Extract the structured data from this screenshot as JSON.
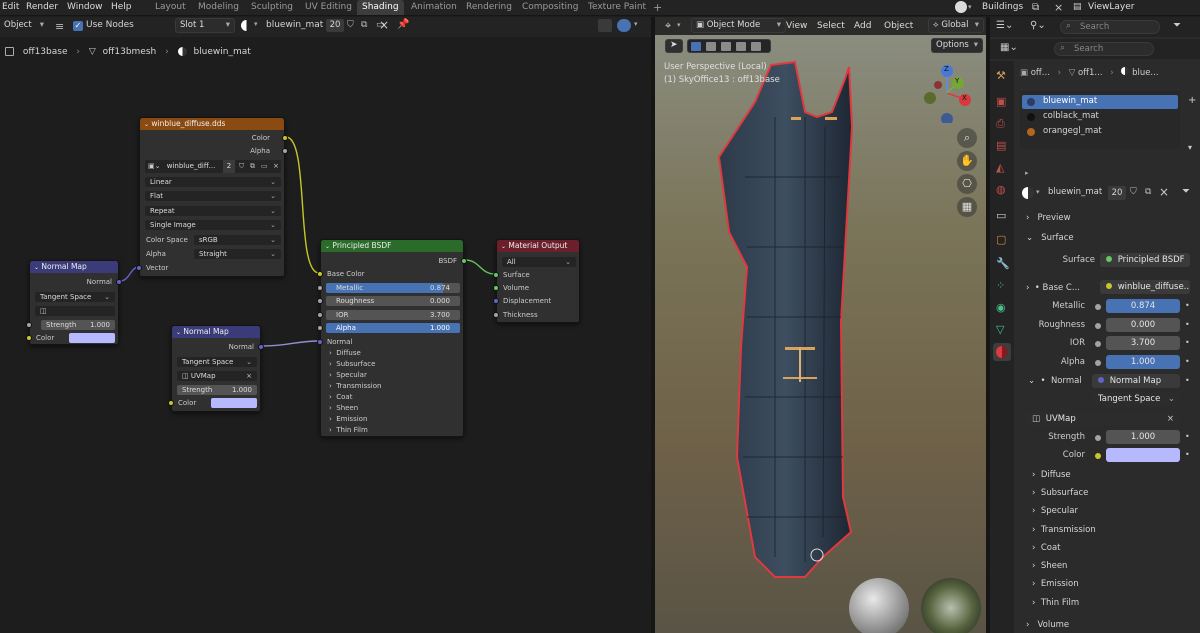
{
  "topbar": {
    "menus": [
      "Edit",
      "Render",
      "Window",
      "Help"
    ],
    "workspaces": [
      "Layout",
      "Modeling",
      "Sculpting",
      "UV Editing",
      "Shading",
      "Animation",
      "Rendering",
      "Compositing",
      "Texture Paint"
    ],
    "active_workspace": "Shading",
    "plus": "+",
    "scene": "Buildings",
    "viewlayer": "ViewLayer"
  },
  "node_editor": {
    "mode": "Object",
    "use_nodes": "Use Nodes",
    "slot": "Slot 1",
    "material": "bluewin_mat",
    "users": "20",
    "breadcrumb": [
      "off13base",
      "off13bmesh",
      "bluewin_mat"
    ],
    "image_node": {
      "title": "winblue_diffuse.dds",
      "out_color": "Color",
      "out_alpha": "Alpha",
      "image_name": "winblue_diff...",
      "image_users": "2",
      "interpolation": "Linear",
      "projection": "Flat",
      "extension": "Repeat",
      "source": "Single Image",
      "color_space_label": "Color Space",
      "color_space": "sRGB",
      "alpha_label": "Alpha",
      "alpha_mode": "Straight",
      "in_vector": "Vector"
    },
    "normal_map_1": {
      "title": "Normal Map",
      "out": "Normal",
      "space": "Tangent Space",
      "strength_label": "Strength",
      "strength": "1.000",
      "color_label": "Color"
    },
    "normal_map_2": {
      "title": "Normal Map",
      "out": "Normal",
      "space": "Tangent Space",
      "uv": "UVMap",
      "strength_label": "Strength",
      "strength": "1.000",
      "color_label": "Color"
    },
    "bsdf": {
      "title": "Principled BSDF",
      "out": "BSDF",
      "base_color": "Base Color",
      "metallic_label": "Metallic",
      "metallic": "0.874",
      "metallic_fill": 0.874,
      "roughness_label": "Roughness",
      "roughness": "0.000",
      "ior_label": "IOR",
      "ior": "3.700",
      "alpha_label": "Alpha",
      "alpha": "1.000",
      "normal": "Normal",
      "panels": [
        "Diffuse",
        "Subsurface",
        "Specular",
        "Transmission",
        "Coat",
        "Sheen",
        "Emission",
        "Thin Film"
      ]
    },
    "output": {
      "title": "Material Output",
      "target": "All",
      "inputs": [
        "Surface",
        "Volume",
        "Displacement",
        "Thickness"
      ]
    }
  },
  "viewport": {
    "mode": "Object Mode",
    "menus": [
      "View",
      "Select",
      "Add",
      "Object"
    ],
    "orientation": "Global",
    "options": "Options",
    "overlay_title": "User Perspective (Local)",
    "overlay_sub": "(1) SkyOffice13 : off13base",
    "axes": {
      "x": "X",
      "y": "Y",
      "z": "Z"
    }
  },
  "properties": {
    "search_placeholder": "Search",
    "breadcrumb": [
      "off...",
      "off1...",
      "blue..."
    ],
    "slots": [
      {
        "name": "bluewin_mat",
        "selected": true,
        "color": "#2a3d66"
      },
      {
        "name": "colblack_mat",
        "selected": false,
        "color": "#111111"
      },
      {
        "name": "orangegl_mat",
        "selected": false,
        "color": "#b5651d"
      }
    ],
    "material": "bluewin_mat",
    "users": "20",
    "preview": "Preview",
    "surface_section": "Surface",
    "surface_label": "Surface",
    "surface_value": "Principled BSDF",
    "base_color_label": "Base C...",
    "base_color_value": "winblue_diffuse....",
    "metallic_label": "Metallic",
    "metallic": "0.874",
    "roughness_label": "Roughness",
    "roughness": "0.000",
    "ior_label": "IOR",
    "ior": "3.700",
    "alpha_label": "Alpha",
    "alpha": "1.000",
    "normal_label": "Normal",
    "normal_value": "Normal Map",
    "tangent": "Tangent Space",
    "uvmap": "UVMap",
    "strength_label": "Strength",
    "strength": "1.000",
    "color_label": "Color",
    "subpanels": [
      "Diffuse",
      "Subsurface",
      "Specular",
      "Transmission",
      "Coat",
      "Sheen",
      "Emission",
      "Thin Film"
    ],
    "volume": "Volume"
  },
  "colors": {
    "accent": "#4772b3",
    "normal_color": "#b7b9ff",
    "image_header": "#8c4a13",
    "bsdf_header": "#2a6b2a",
    "output_header": "#6b1f2a",
    "normal_header": "#3b3b7a",
    "selection_outline": "#e0393f"
  }
}
